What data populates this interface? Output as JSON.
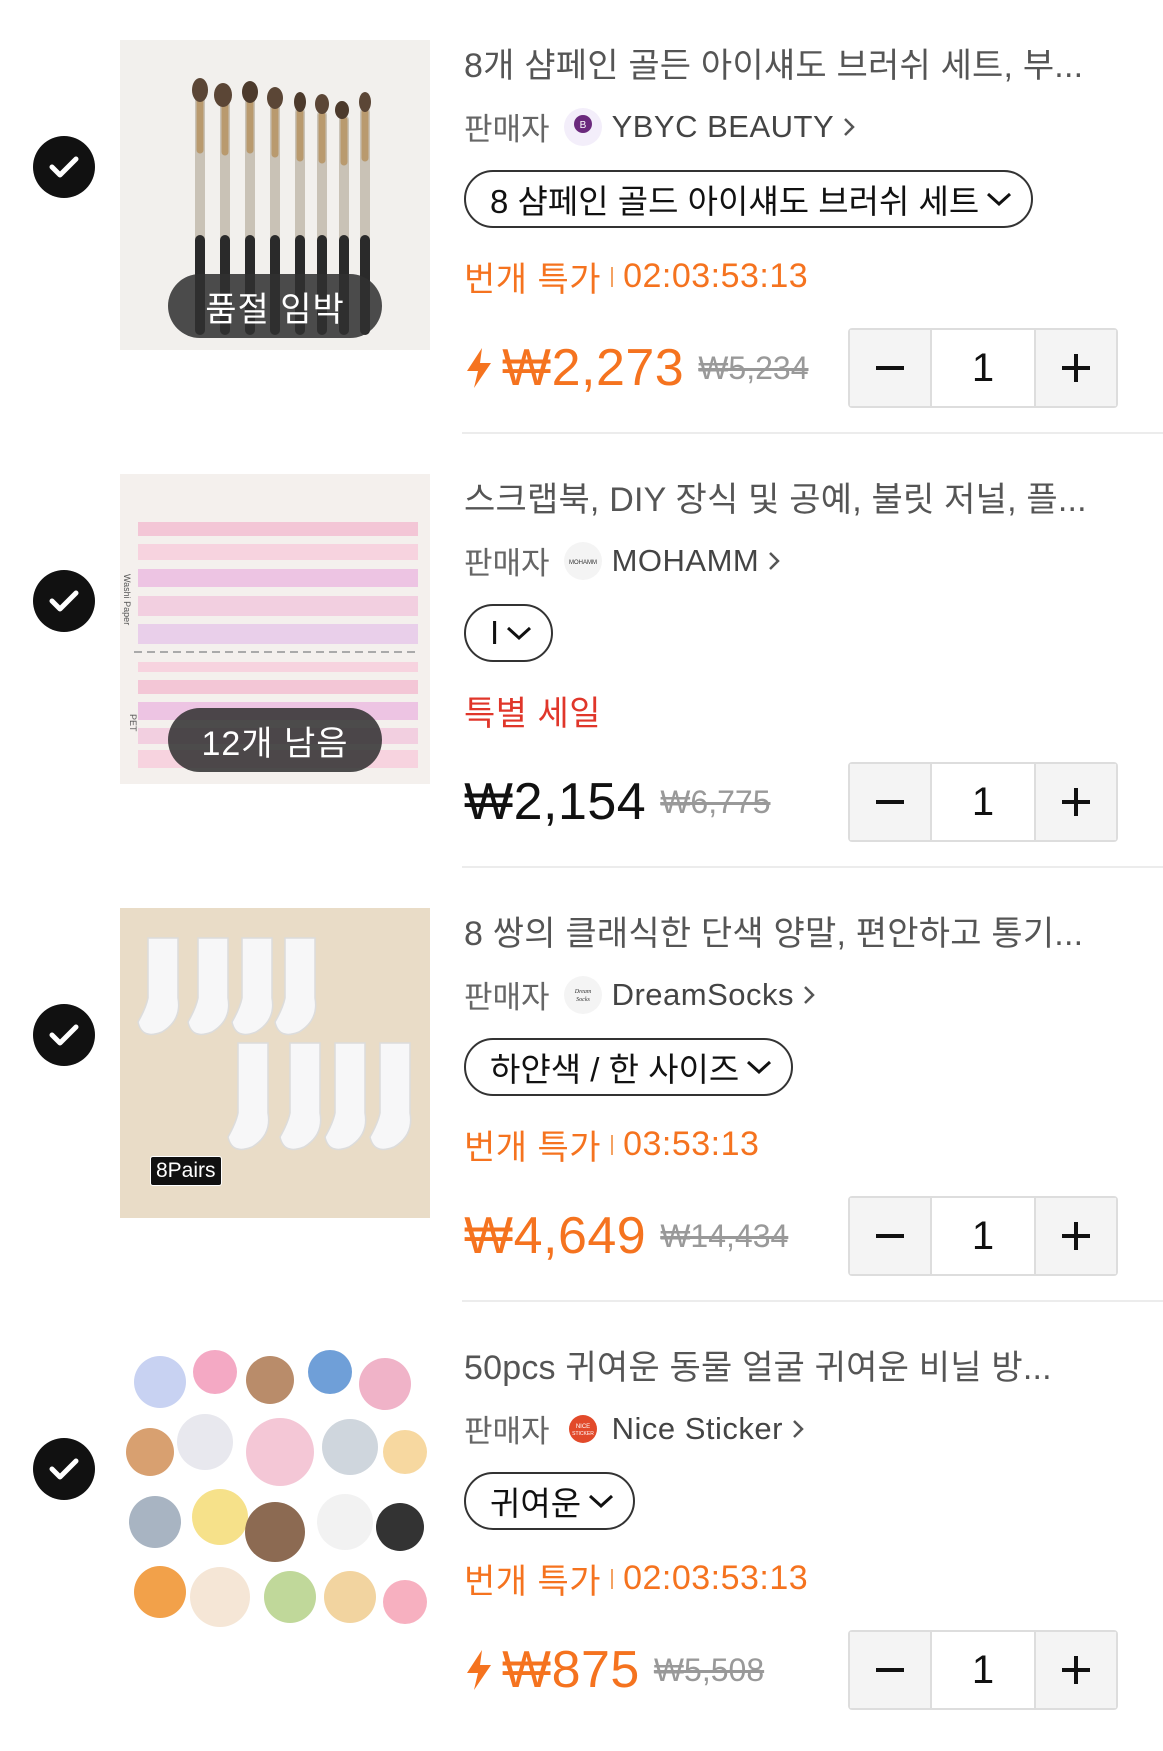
{
  "colors": {
    "accent_orange": "#f5731f",
    "sale_red": "#e0362a",
    "check_bg": "#111111"
  },
  "items": [
    {
      "title": "8개 샴페인 골든 아이섀도 브러쉬 세트, 부...",
      "seller_label": "판매자",
      "seller_name": "YBYC BEAUTY",
      "seller_logo_text": "YBYC BEAUTY",
      "variant": "8 샴페인 골드 아이섀도 브러쉬 세트",
      "promo_label": "번개 특가",
      "promo_timer": "02:03:53:13",
      "price": "₩2,273",
      "original_price": "₩5,234",
      "quantity": "1",
      "image_badge": "품절 임박",
      "image_icon": "eyeshadow-brush-set",
      "checked": true
    },
    {
      "title": "스크랩북, DIY 장식 및 공예, 불릿 저널, 플...",
      "seller_label": "판매자",
      "seller_name": "MOHAMM",
      "seller_logo_text": "MOHAMM",
      "variant": "I",
      "promo_label": "특별 세일",
      "price": "₩2,154",
      "original_price": "₩6,775",
      "quantity": "1",
      "image_badge": "12개 남음",
      "image_text_top": "Washi Paper",
      "image_text_bottom": "PET",
      "image_icon": "washi-tape-stickers",
      "checked": true
    },
    {
      "title": "8 쌍의 클래식한 단색 양말, 편안하고 통기...",
      "seller_label": "판매자",
      "seller_name": "DreamSocks",
      "seller_logo_text": "Dream Socks",
      "variant": "하얀색 / 한 사이즈",
      "promo_label": "번개 특가",
      "promo_timer": "03:53:13",
      "price": "₩4,649",
      "original_price": "₩14,434",
      "quantity": "1",
      "image_tag": "8Pairs",
      "image_icon": "white-socks",
      "checked": true
    },
    {
      "title": "50pcs 귀여운 동물 얼굴 귀여운 비닐 방...",
      "seller_label": "판매자",
      "seller_name": "Nice Sticker",
      "seller_logo_text": "NICE STICKER",
      "variant": "귀여운",
      "promo_label": "번개 특가",
      "promo_timer": "02:03:53:13",
      "price": "₩875",
      "original_price": "₩5,508",
      "quantity": "1",
      "image_icon": "animal-stickers",
      "checked": true
    }
  ]
}
